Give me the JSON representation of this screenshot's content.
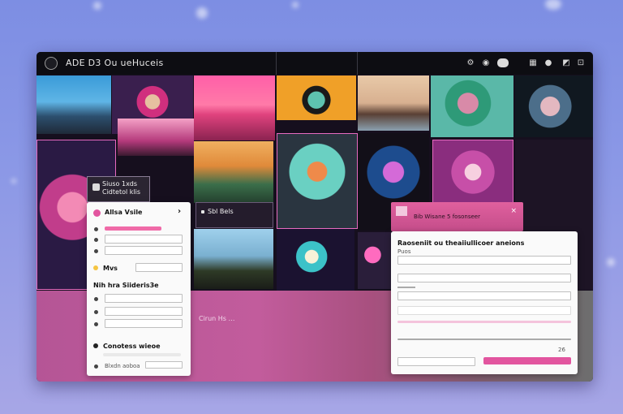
{
  "window": {
    "title": "ADE D3 Ou ueHuceis"
  },
  "toolbar": {
    "icons": [
      "settings-icon",
      "view-icon",
      "toggle-icon",
      "grid-icon",
      "chat-icon",
      "share-icon"
    ]
  },
  "card_small": {
    "line1": "Siuso 1xds",
    "line2": "Cidtetol klis"
  },
  "tile_caption": "Sbl Bels",
  "pink_card": {
    "label": "Bib Wisane 5 fosonseer",
    "close": "×"
  },
  "left_panel": {
    "row1_title": "Allsa Vsile",
    "row1_arrow": "›",
    "section2_title": "Mvs",
    "section3_title": "Nih hra Siideris3e",
    "section4_title": "Conotess wieoe",
    "footer_text": "Blxdn aoboa"
  },
  "right_panel": {
    "title": "Raoseniit ou theaiiullicoer aneions",
    "label1": "Puos",
    "switch_label": "26"
  },
  "band_caption": "Cirun Hs …",
  "colors": {
    "accent": "#e2559f",
    "window": "#160f1e",
    "panel": "#fafafa"
  }
}
